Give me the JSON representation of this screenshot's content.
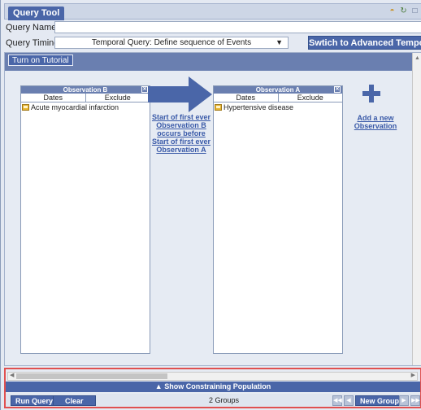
{
  "header": {
    "tool_tab": "Query Tool",
    "icons": [
      "help-icon",
      "refresh-icon",
      "window-icon"
    ]
  },
  "query_name": {
    "label": "Query Name:",
    "value": ""
  },
  "timing": {
    "label": "Query Timing:",
    "selected": "Temporal Query: Define sequence of Events",
    "advanced_button": "Swtich to Advanced Temporal Query"
  },
  "workspace": {
    "tutorial_button": "Turn on Tutorial",
    "observation_b": {
      "title": "Observation B",
      "col_dates": "Dates",
      "col_exclude": "Exclude",
      "item": "Acute myocardial infarction"
    },
    "observation_a": {
      "title": "Observation A",
      "col_dates": "Dates",
      "col_exclude": "Exclude",
      "item": "Hypertensive disease"
    },
    "sequence_lines": [
      "Start of first ever",
      "Observation B",
      "occurs before",
      "Start of first ever",
      "Observation A"
    ],
    "add_observation_lines": [
      "Add a new",
      "Observation"
    ]
  },
  "bottom": {
    "constraining_label": "▲ Show Constraining Population",
    "run_query": "Run Query",
    "clear": "Clear",
    "groups_count": "2 Groups",
    "new_group": "New Group"
  },
  "colors": {
    "accent": "#4a66a8",
    "panel_header": "#6a7fb0",
    "link": "#3a5aa8",
    "highlight_border": "#e05050"
  }
}
